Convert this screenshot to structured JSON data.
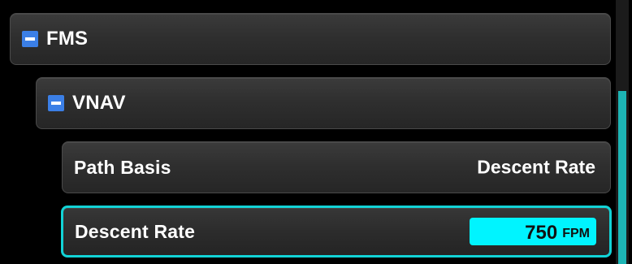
{
  "tree": {
    "fms": {
      "label": "FMS",
      "toggle_state": "expanded"
    },
    "vnav": {
      "label": "VNAV",
      "toggle_state": "expanded"
    },
    "path_basis": {
      "label": "Path Basis",
      "value": "Descent Rate"
    },
    "descent_rate": {
      "label": "Descent Rate",
      "value": "750",
      "unit": "FPM",
      "selected": true
    }
  },
  "colors": {
    "toggle": "#3b7fe6",
    "selection_border": "#12d3d6",
    "value_highlight": "#00f4ff",
    "scrollbar_thumb": "#1db5b5",
    "row_background": "#2f2f2f"
  },
  "icons": {
    "collapse_toggle": "minus-square-icon"
  },
  "scrollbar": {
    "position_fraction": 0.35
  }
}
